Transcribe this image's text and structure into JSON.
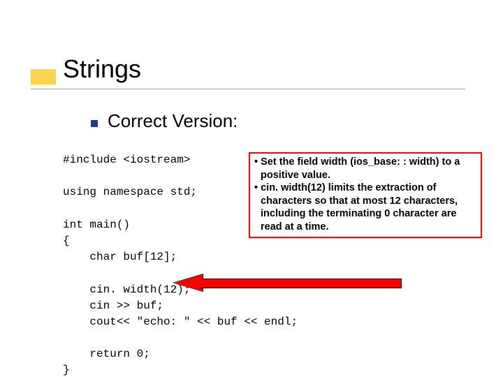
{
  "title": "Strings",
  "subtitle": "Correct Version:",
  "code": "#include <iostream>\n\nusing namespace std;\n\nint main()\n{\n    char buf[12];\n\n    cin. width(12);\n    cin >> buf;\n    cout<< \"echo: \" << buf << endl;\n\n    return 0;\n}",
  "callout": {
    "b1": "• Set the field width (ios_base: : width) to a positive value.",
    "b2": "• cin. width(12) limits the extraction of characters so that at most 12 characters, including the terminating 0 character are read at a time."
  }
}
